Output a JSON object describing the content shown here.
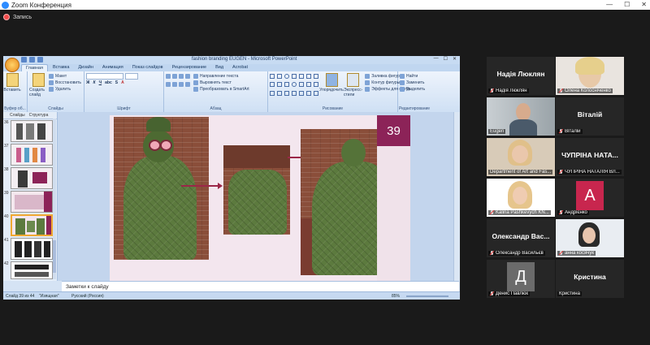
{
  "app": {
    "title": "Zoom Конференция",
    "recording_label": "Запись"
  },
  "ppt": {
    "doc_title": "fashion branding EUGEN - Microsoft PowerPoint",
    "tabs": [
      "Главная",
      "Вставка",
      "Дизайн",
      "Анимация",
      "Показ слайдов",
      "Рецензирование",
      "Вид",
      "Acrobat"
    ],
    "ribbon": {
      "paste": "Вставить",
      "new_slide": "Создать слайд",
      "layout": "Макет",
      "restore": "Восстановить",
      "delete": "Удалить",
      "slides_group": "Слайды",
      "font_group": "Шрифт",
      "paragraph_group": "Абзац",
      "drawing_group": "Рисование",
      "editing_group": "Редактирование",
      "clipboard_group": "Буфер об...",
      "text_direction": "Направление текста",
      "align_text": "Выровнять текст",
      "smartart": "Преобразовать в SmartArt",
      "arrange": "Упорядочить",
      "quick_styles": "Экспресс-стили",
      "shape_fill": "Заливка фигуры",
      "shape_outline": "Контур фигуры",
      "shape_effects": "Эффекты для фигур",
      "find": "Найти",
      "replace": "Заменить",
      "select": "Выделить"
    },
    "panel_tabs": [
      "Слайды",
      "Структура"
    ],
    "thumb_numbers": [
      "36",
      "37",
      "38",
      "39",
      "40",
      "41",
      "42"
    ],
    "slide_number": "39",
    "notes_placeholder": "Заметки к слайду",
    "status": {
      "slide": "Слайд 39 из 44",
      "theme": "\"Изящная\"",
      "lang": "Русский (Россия)",
      "zoom": "85%"
    }
  },
  "participants": [
    {
      "big_name": "Надія Люклян",
      "label": "Надія Люклян",
      "type": "name"
    },
    {
      "big_name": "",
      "label": "Олена Колосніченко",
      "type": "photo"
    },
    {
      "big_name": "",
      "label": "Eugen",
      "type": "photo-active"
    },
    {
      "big_name": "Віталій",
      "label": "Віталій",
      "type": "name"
    },
    {
      "big_name": "",
      "label": "Department of Art and Fas...",
      "type": "photo"
    },
    {
      "big_name": "ЧУПРІНА НАТА...",
      "label": "ЧУПРІНА НАТАЛІЯ ВЛ...",
      "type": "name"
    },
    {
      "big_name": "",
      "label": "Kalina Pashkevych KN...",
      "type": "photo"
    },
    {
      "big_name": "A",
      "label": "Андрієнко",
      "type": "avatar",
      "avatar_color": "#c8264e"
    },
    {
      "big_name": "Олександр Вас...",
      "label": "Олександр Васильєв",
      "type": "name"
    },
    {
      "big_name": "",
      "label": "анна косячук",
      "type": "photo"
    },
    {
      "big_name": "Д",
      "label": "Денис Павлюк",
      "type": "avatar",
      "avatar_color": "#6b6b6b"
    },
    {
      "big_name": "Кристина",
      "label": "Кристина",
      "type": "name"
    }
  ],
  "colors": {
    "accent": "#8c2358",
    "active_speaker": "#c5e04a",
    "zoom_blue": "#2d8cff"
  }
}
